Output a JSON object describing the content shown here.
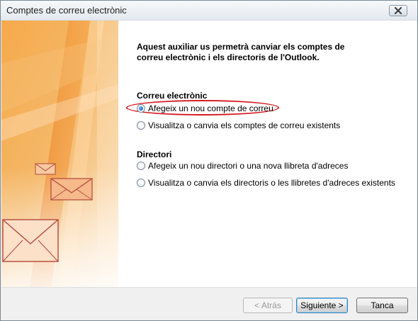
{
  "window": {
    "title": "Comptes de correu electrònic"
  },
  "icons": {
    "close": "close-icon"
  },
  "intro": {
    "text": "Aquest auxiliar us permetrà canviar els comptes de correu electrònic i els directoris de l'Outlook."
  },
  "email_section": {
    "title": "Correu electrònic",
    "options": [
      {
        "label": "Afegeix un nou compte de correu",
        "checked": true
      },
      {
        "label": "Visualitza o canvia els comptes de correu existents",
        "checked": false
      }
    ]
  },
  "directory_section": {
    "title": "Directori",
    "options": [
      {
        "label": "Afegeix un nou directori o una nova llibreta d'adreces",
        "checked": false
      },
      {
        "label": "Visualitza o canvia els directoris o les llibretes d'adreces existents",
        "checked": false
      }
    ]
  },
  "buttons": {
    "back": "< Atrás",
    "next": "Siguiente >",
    "close": "Tanca"
  },
  "colors": {
    "highlight": "#d4181f",
    "art_orange": "#f08a1c"
  }
}
